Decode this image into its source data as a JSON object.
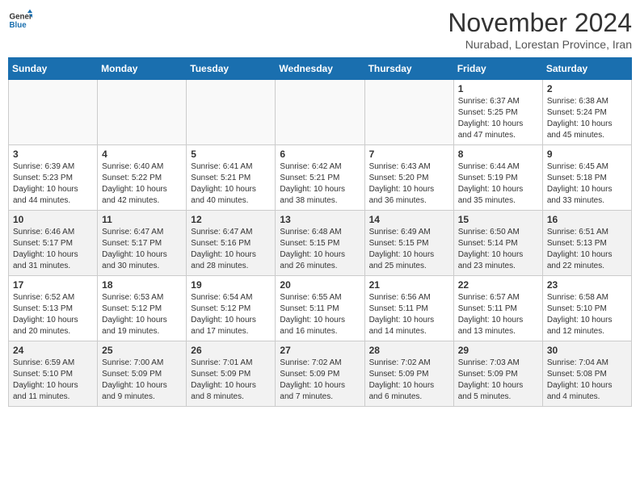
{
  "header": {
    "logo_line1": "General",
    "logo_line2": "Blue",
    "month": "November 2024",
    "location": "Nurabad, Lorestan Province, Iran"
  },
  "weekdays": [
    "Sunday",
    "Monday",
    "Tuesday",
    "Wednesday",
    "Thursday",
    "Friday",
    "Saturday"
  ],
  "weeks": [
    [
      {
        "day": "",
        "info": ""
      },
      {
        "day": "",
        "info": ""
      },
      {
        "day": "",
        "info": ""
      },
      {
        "day": "",
        "info": ""
      },
      {
        "day": "",
        "info": ""
      },
      {
        "day": "1",
        "info": "Sunrise: 6:37 AM\nSunset: 5:25 PM\nDaylight: 10 hours and 47 minutes."
      },
      {
        "day": "2",
        "info": "Sunrise: 6:38 AM\nSunset: 5:24 PM\nDaylight: 10 hours and 45 minutes."
      }
    ],
    [
      {
        "day": "3",
        "info": "Sunrise: 6:39 AM\nSunset: 5:23 PM\nDaylight: 10 hours and 44 minutes."
      },
      {
        "day": "4",
        "info": "Sunrise: 6:40 AM\nSunset: 5:22 PM\nDaylight: 10 hours and 42 minutes."
      },
      {
        "day": "5",
        "info": "Sunrise: 6:41 AM\nSunset: 5:21 PM\nDaylight: 10 hours and 40 minutes."
      },
      {
        "day": "6",
        "info": "Sunrise: 6:42 AM\nSunset: 5:21 PM\nDaylight: 10 hours and 38 minutes."
      },
      {
        "day": "7",
        "info": "Sunrise: 6:43 AM\nSunset: 5:20 PM\nDaylight: 10 hours and 36 minutes."
      },
      {
        "day": "8",
        "info": "Sunrise: 6:44 AM\nSunset: 5:19 PM\nDaylight: 10 hours and 35 minutes."
      },
      {
        "day": "9",
        "info": "Sunrise: 6:45 AM\nSunset: 5:18 PM\nDaylight: 10 hours and 33 minutes."
      }
    ],
    [
      {
        "day": "10",
        "info": "Sunrise: 6:46 AM\nSunset: 5:17 PM\nDaylight: 10 hours and 31 minutes."
      },
      {
        "day": "11",
        "info": "Sunrise: 6:47 AM\nSunset: 5:17 PM\nDaylight: 10 hours and 30 minutes."
      },
      {
        "day": "12",
        "info": "Sunrise: 6:47 AM\nSunset: 5:16 PM\nDaylight: 10 hours and 28 minutes."
      },
      {
        "day": "13",
        "info": "Sunrise: 6:48 AM\nSunset: 5:15 PM\nDaylight: 10 hours and 26 minutes."
      },
      {
        "day": "14",
        "info": "Sunrise: 6:49 AM\nSunset: 5:15 PM\nDaylight: 10 hours and 25 minutes."
      },
      {
        "day": "15",
        "info": "Sunrise: 6:50 AM\nSunset: 5:14 PM\nDaylight: 10 hours and 23 minutes."
      },
      {
        "day": "16",
        "info": "Sunrise: 6:51 AM\nSunset: 5:13 PM\nDaylight: 10 hours and 22 minutes."
      }
    ],
    [
      {
        "day": "17",
        "info": "Sunrise: 6:52 AM\nSunset: 5:13 PM\nDaylight: 10 hours and 20 minutes."
      },
      {
        "day": "18",
        "info": "Sunrise: 6:53 AM\nSunset: 5:12 PM\nDaylight: 10 hours and 19 minutes."
      },
      {
        "day": "19",
        "info": "Sunrise: 6:54 AM\nSunset: 5:12 PM\nDaylight: 10 hours and 17 minutes."
      },
      {
        "day": "20",
        "info": "Sunrise: 6:55 AM\nSunset: 5:11 PM\nDaylight: 10 hours and 16 minutes."
      },
      {
        "day": "21",
        "info": "Sunrise: 6:56 AM\nSunset: 5:11 PM\nDaylight: 10 hours and 14 minutes."
      },
      {
        "day": "22",
        "info": "Sunrise: 6:57 AM\nSunset: 5:11 PM\nDaylight: 10 hours and 13 minutes."
      },
      {
        "day": "23",
        "info": "Sunrise: 6:58 AM\nSunset: 5:10 PM\nDaylight: 10 hours and 12 minutes."
      }
    ],
    [
      {
        "day": "24",
        "info": "Sunrise: 6:59 AM\nSunset: 5:10 PM\nDaylight: 10 hours and 11 minutes."
      },
      {
        "day": "25",
        "info": "Sunrise: 7:00 AM\nSunset: 5:09 PM\nDaylight: 10 hours and 9 minutes."
      },
      {
        "day": "26",
        "info": "Sunrise: 7:01 AM\nSunset: 5:09 PM\nDaylight: 10 hours and 8 minutes."
      },
      {
        "day": "27",
        "info": "Sunrise: 7:02 AM\nSunset: 5:09 PM\nDaylight: 10 hours and 7 minutes."
      },
      {
        "day": "28",
        "info": "Sunrise: 7:02 AM\nSunset: 5:09 PM\nDaylight: 10 hours and 6 minutes."
      },
      {
        "day": "29",
        "info": "Sunrise: 7:03 AM\nSunset: 5:09 PM\nDaylight: 10 hours and 5 minutes."
      },
      {
        "day": "30",
        "info": "Sunrise: 7:04 AM\nSunset: 5:08 PM\nDaylight: 10 hours and 4 minutes."
      }
    ]
  ]
}
